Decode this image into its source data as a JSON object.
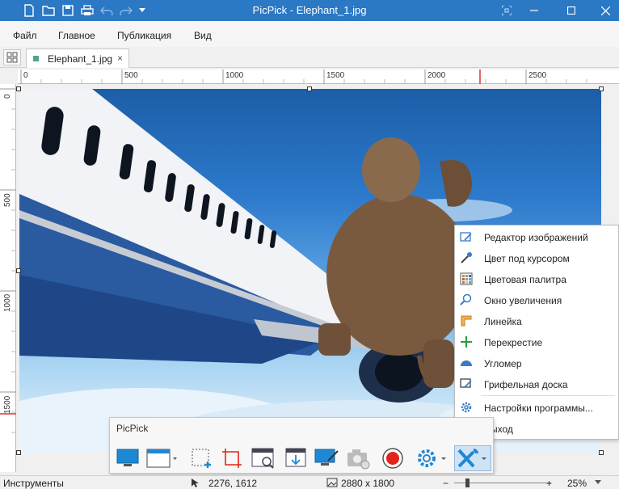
{
  "window": {
    "title": "PicPick - Elephant_1.jpg"
  },
  "quick_access": [
    "new-file-icon",
    "open-folder-icon",
    "save-icon",
    "print-icon",
    "undo-icon",
    "redo-icon",
    "dropdown-icon"
  ],
  "menu": {
    "items": [
      "Файл",
      "Главное",
      "Публикация",
      "Вид"
    ]
  },
  "tab": {
    "label": "Elephant_1.jpg",
    "close": "×"
  },
  "ruler": {
    "h_labels": [
      "0",
      "500",
      "1000",
      "1500",
      "2000",
      "2500"
    ],
    "v_labels": [
      "0",
      "500",
      "1000",
      "1500"
    ]
  },
  "context_menu": {
    "items": [
      {
        "label": "Редактор изображений",
        "icon": "image-editor-icon"
      },
      {
        "label": "Цвет под курсором",
        "icon": "eyedropper-icon"
      },
      {
        "label": "Цветовая палитра",
        "icon": "color-palette-icon"
      },
      {
        "label": "Окно увеличения",
        "icon": "magnifier-icon"
      },
      {
        "label": "Линейка",
        "icon": "ruler-icon"
      },
      {
        "label": "Перекрестие",
        "icon": "crosshair-icon"
      },
      {
        "label": "Угломер",
        "icon": "protractor-icon"
      },
      {
        "label": "Грифельная доска",
        "icon": "whiteboard-icon"
      },
      {
        "label": "Настройки программы...",
        "icon": "settings-gear-icon"
      },
      {
        "label": "Выход",
        "icon": ""
      }
    ]
  },
  "picbar": {
    "title": "PicPick"
  },
  "status": {
    "tools_label": "Инструменты",
    "cursor_pos": "2276, 1612",
    "image_size": "2880 x 1800",
    "zoom": "25%"
  },
  "colors": {
    "titlebar": "#2b78c5",
    "accent": "#1e88d3",
    "record": "#e2231a"
  }
}
